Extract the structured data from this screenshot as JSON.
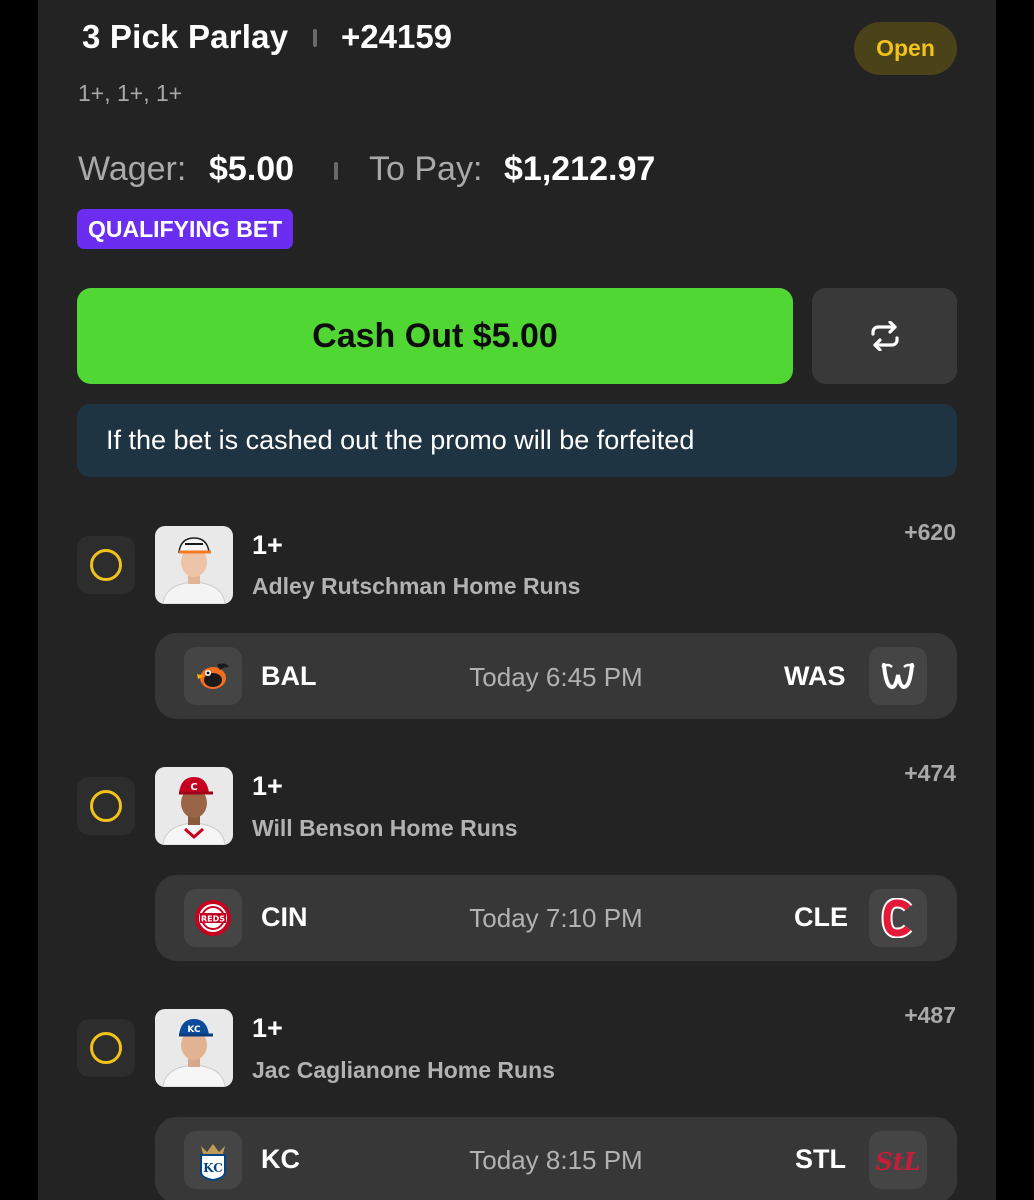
{
  "bet": {
    "title": "3 Pick Parlay",
    "odds": "+24159",
    "status": "Open",
    "legs_summary": "1+, 1+, 1+",
    "wager_label": "Wager:",
    "wager": "$5.00",
    "to_pay_label": "To Pay:",
    "to_pay": "$1,212.97",
    "badge": "QUALIFYING BET",
    "cashout_label": "Cash Out $5.00",
    "refresh_icon": "refresh-icon",
    "promo_notice": "If the bet is cashed out the promo will be forfeited"
  },
  "legs": [
    {
      "line": "1+",
      "description": "Adley Rutschman Home Runs",
      "odds": "+620",
      "away": "BAL",
      "home": "WAS",
      "time": "Today 6:45 PM",
      "away_icon": "orioles-logo-icon",
      "home_icon": "nationals-logo-icon"
    },
    {
      "line": "1+",
      "description": "Will Benson Home Runs",
      "odds": "+474",
      "away": "CIN",
      "home": "CLE",
      "time": "Today 7:10 PM",
      "away_icon": "reds-logo-icon",
      "home_icon": "guardians-logo-icon"
    },
    {
      "line": "1+",
      "description": "Jac Caglianone Home Runs",
      "odds": "+487",
      "away": "KC",
      "home": "STL",
      "time": "Today 8:15 PM",
      "away_icon": "royals-logo-icon",
      "home_icon": "cardinals-logo-icon"
    }
  ],
  "colors": {
    "accent_green": "#51d734",
    "status_yellow": "#f1c21b",
    "badge_purple": "#6b2ef0",
    "promo_bg": "#1f3443"
  }
}
